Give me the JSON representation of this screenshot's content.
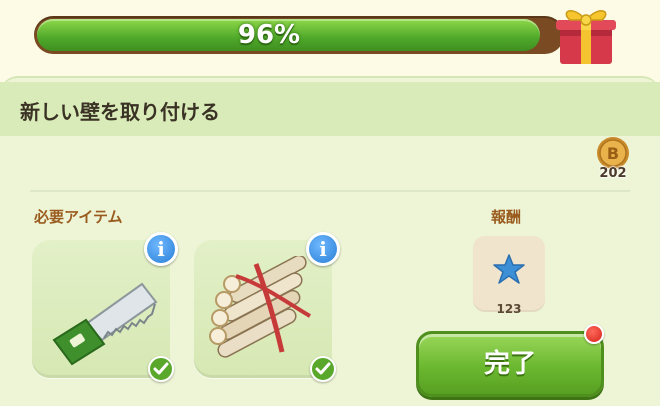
{
  "progress": {
    "percent_label": "96%",
    "fraction": 0.96
  },
  "task": {
    "title": "新しい壁を取り付ける"
  },
  "currency": {
    "icon": "coin-icon",
    "letter": "B",
    "count": "202"
  },
  "required": {
    "label": "必要アイテム",
    "items": [
      {
        "icon": "saw-icon",
        "info_label": "i"
      },
      {
        "icon": "log-bundle-icon",
        "info_label": "i"
      }
    ]
  },
  "reward": {
    "label": "報酬",
    "icon": "blue-star-icon",
    "count": "123"
  },
  "complete_button": {
    "label": "完了"
  },
  "colors": {
    "progress_green": "#4fa82a",
    "button_green": "#6bb830",
    "notification_red": "#d4221a"
  }
}
